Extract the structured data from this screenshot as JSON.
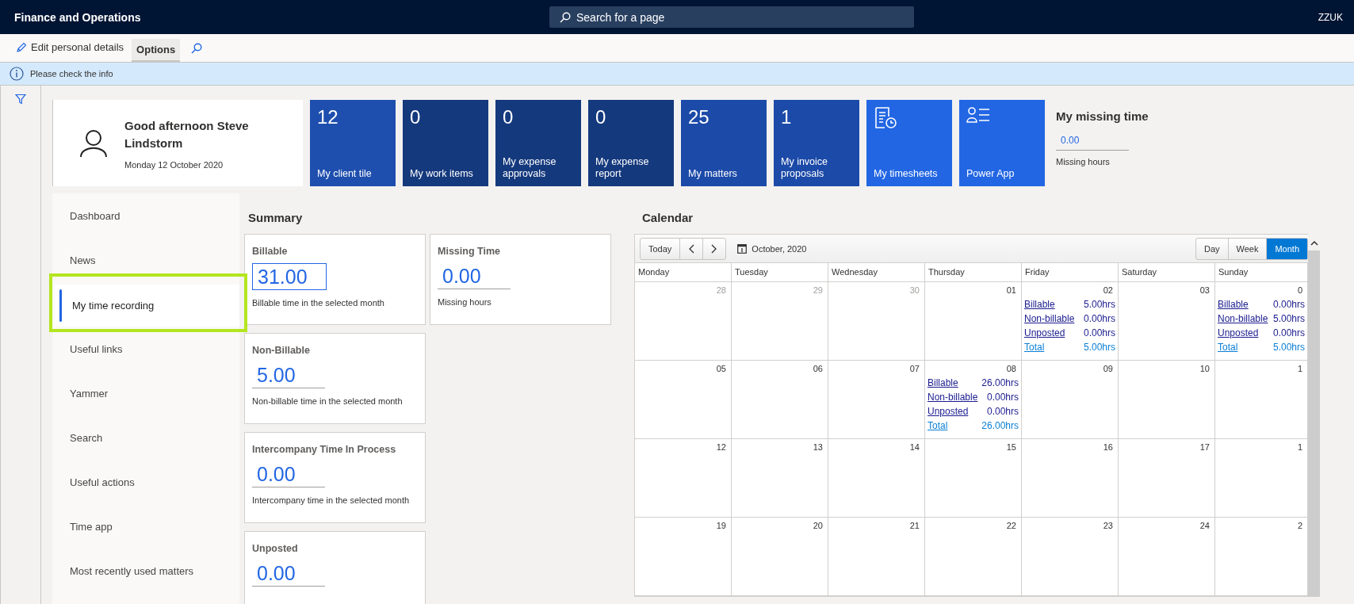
{
  "app": {
    "title": "Finance and Operations",
    "search": {
      "placeholder": "Search for a page"
    },
    "company": "ZZUK"
  },
  "toolbar": {
    "items": [
      {
        "label": "Edit personal details",
        "kind": "action",
        "selected": false
      },
      {
        "label": "Options",
        "kind": "tab",
        "selected": true
      }
    ]
  },
  "info_bar": {
    "message": "Please check the info"
  },
  "profile": {
    "greeting": "Good afternoon Steve Lindstorm",
    "date": "Monday 12 October 2020"
  },
  "tiles": [
    {
      "kind": "count",
      "count": "12",
      "label": "My client tile",
      "color": "#1f4fae"
    },
    {
      "kind": "count",
      "count": "0",
      "label": "My work items",
      "color": "#15397d"
    },
    {
      "kind": "count",
      "count": "0",
      "label": "My expense approvals",
      "color": "#15397d"
    },
    {
      "kind": "count",
      "count": "0",
      "label": "My expense report",
      "color": "#15397d"
    },
    {
      "kind": "count",
      "count": "25",
      "label": "My matters",
      "color": "#1c4aa8"
    },
    {
      "kind": "count",
      "count": "1",
      "label": "My invoice proposals",
      "color": "#1c4aa8"
    },
    {
      "kind": "document",
      "label": "My timesheets",
      "color": "#2266e3"
    },
    {
      "kind": "people",
      "label": "Power App",
      "color": "#2266e3"
    }
  ],
  "missing_time": {
    "title": "My missing time",
    "value": "0.00",
    "caption": "Missing hours"
  },
  "nav": {
    "items": [
      {
        "label": "Dashboard",
        "selected": false
      },
      {
        "label": "News",
        "selected": false
      },
      {
        "label": "My time recording",
        "selected": true
      },
      {
        "label": "Useful links",
        "selected": false
      },
      {
        "label": "Yammer",
        "selected": false
      },
      {
        "label": "Search",
        "selected": false
      },
      {
        "label": "Useful actions",
        "selected": false
      },
      {
        "label": "Time app",
        "selected": false
      },
      {
        "label": "Most recently used matters",
        "selected": false
      }
    ]
  },
  "summary": {
    "title": "Summary",
    "columns": [
      {
        "cards": [
          {
            "title": "Billable",
            "value": "31.00",
            "caption": "Billable time in the selected month",
            "focused": true
          },
          {
            "title": "Non-Billable",
            "value": "5.00",
            "caption": "Non-billable time in the selected month",
            "focused": false
          },
          {
            "title": "Intercompany Time In Process",
            "value": "0.00",
            "caption": "Intercompany time in the selected month",
            "focused": false
          },
          {
            "title": "Unposted",
            "value": "0.00",
            "focused": false
          }
        ]
      },
      {
        "cards": [
          {
            "title": "Missing Time",
            "value": "0.00",
            "caption": "Missing hours",
            "focused": false
          }
        ]
      }
    ]
  },
  "calendar": {
    "title": "Calendar",
    "today": "Today",
    "period": "October, 2020",
    "views": [
      {
        "label": "Day",
        "selected": false
      },
      {
        "label": "Week",
        "selected": false
      },
      {
        "label": "Month",
        "selected": true
      }
    ],
    "weekdays": [
      "Monday",
      "Tuesday",
      "Wednesday",
      "Thursday",
      "Friday",
      "Saturday",
      "Sunday"
    ],
    "weeks": [
      {
        "days": [
          {
            "date": "28",
            "muted": true
          },
          {
            "date": "29",
            "muted": true
          },
          {
            "date": "30",
            "muted": true
          },
          {
            "date": "01",
            "muted": false
          },
          {
            "date": "02",
            "muted": false,
            "entries": [
              {
                "label": "Billable",
                "value": "5.00hrs",
                "kind": "link"
              },
              {
                "label": "Non-billable",
                "value": "0.00hrs",
                "kind": "link"
              },
              {
                "label": "Unposted",
                "value": "0.00hrs",
                "kind": "link"
              },
              {
                "label": "Total",
                "value": "5.00hrs",
                "kind": "total"
              }
            ]
          },
          {
            "date": "03",
            "muted": false
          },
          {
            "date": "0",
            "muted": false,
            "entries": [
              {
                "label": "Billable",
                "value": "0.00hrs",
                "kind": "link"
              },
              {
                "label": "Non-billable",
                "value": "5.00hrs",
                "kind": "link"
              },
              {
                "label": "Unposted",
                "value": "0.00hrs",
                "kind": "link"
              },
              {
                "label": "Total",
                "value": "5.00hrs",
                "kind": "total"
              }
            ]
          }
        ]
      },
      {
        "days": [
          {
            "date": "05",
            "muted": false
          },
          {
            "date": "06",
            "muted": false
          },
          {
            "date": "07",
            "muted": false
          },
          {
            "date": "08",
            "muted": false,
            "entries": [
              {
                "label": "Billable",
                "value": "26.00hrs",
                "kind": "link"
              },
              {
                "label": "Non-billable",
                "value": "0.00hrs",
                "kind": "link"
              },
              {
                "label": "Unposted",
                "value": "0.00hrs",
                "kind": "link"
              },
              {
                "label": "Total",
                "value": "26.00hrs",
                "kind": "total"
              }
            ]
          },
          {
            "date": "09",
            "muted": false
          },
          {
            "date": "10",
            "muted": false
          },
          {
            "date": "1",
            "muted": false
          }
        ]
      },
      {
        "days": [
          {
            "date": "12",
            "muted": false
          },
          {
            "date": "13",
            "muted": false
          },
          {
            "date": "14",
            "muted": false
          },
          {
            "date": "15",
            "muted": false
          },
          {
            "date": "16",
            "muted": false
          },
          {
            "date": "17",
            "muted": false
          },
          {
            "date": "1",
            "muted": false
          }
        ]
      },
      {
        "days": [
          {
            "date": "19",
            "muted": false
          },
          {
            "date": "20",
            "muted": false
          },
          {
            "date": "21",
            "muted": false
          },
          {
            "date": "22",
            "muted": false
          },
          {
            "date": "23",
            "muted": false
          },
          {
            "date": "24",
            "muted": false
          },
          {
            "date": "2",
            "muted": false
          }
        ]
      }
    ]
  }
}
